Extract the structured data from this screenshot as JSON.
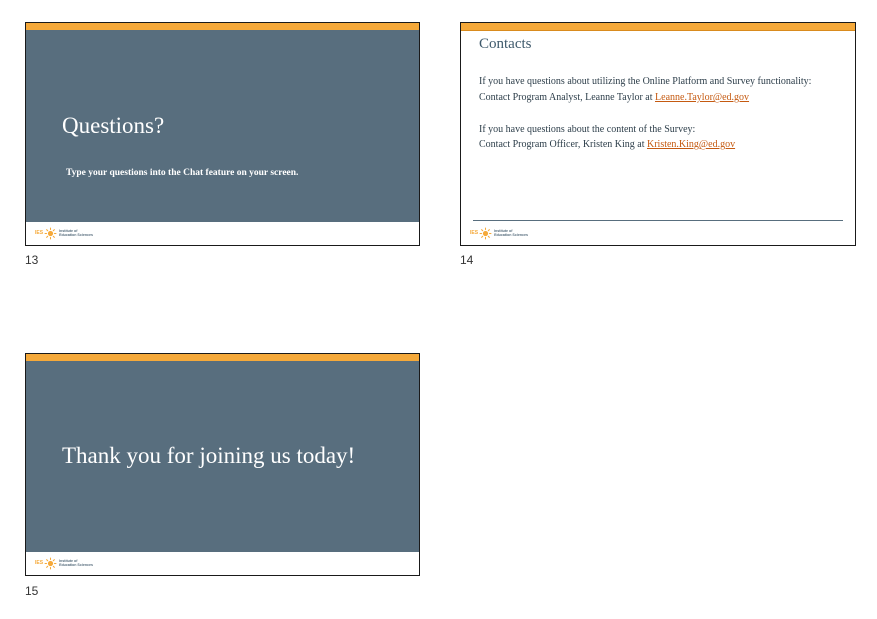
{
  "slides": [
    {
      "number": "13",
      "title": "Questions?",
      "subtitle": "Type your questions into the Chat feature on your screen."
    },
    {
      "number": "14",
      "title": "Contacts",
      "block1_line1": "If you have questions about utilizing the Online Platform and Survey functionality:",
      "block1_line2_prefix": "Contact Program Analyst, Leanne Taylor at ",
      "block1_email": "Leanne.Taylor@ed.gov",
      "block2_line1": "If you have questions about the content of the Survey:",
      "block2_line2_prefix": "Contact Program Officer, Kristen King at ",
      "block2_email": "Kristen.King@ed.gov"
    },
    {
      "number": "15",
      "title": "Thank you for joining us today!"
    }
  ],
  "logo": {
    "acronym": "IES",
    "line1": "Institute of",
    "line2": "Education Sciences"
  },
  "colors": {
    "accent_orange": "#f5a93a",
    "slate": "#586e7e",
    "link": "#c55a11"
  }
}
